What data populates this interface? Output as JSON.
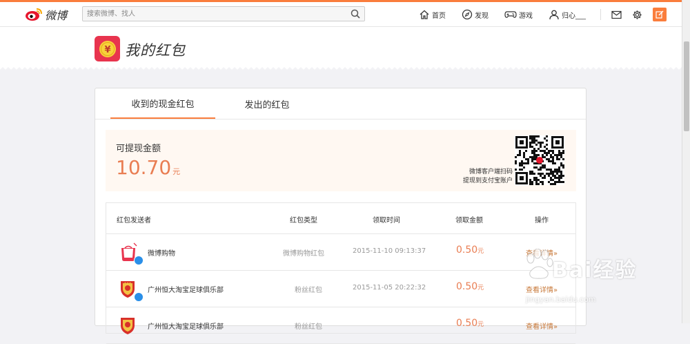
{
  "nav": {
    "logo_text": "微博",
    "search_placeholder": "搜索微博、找人",
    "items": [
      {
        "label": "首页",
        "icon": "home-icon"
      },
      {
        "label": "发现",
        "icon": "compass-icon"
      },
      {
        "label": "游戏",
        "icon": "gamepad-icon"
      },
      {
        "label": "归心___",
        "icon": "user-icon"
      }
    ],
    "right_icons": [
      "mail-icon",
      "gear-icon",
      "compose-icon"
    ]
  },
  "page": {
    "title": "我的红包",
    "hongbao_symbol": "¥"
  },
  "tabs": [
    {
      "label": "收到的现金红包",
      "active": true
    },
    {
      "label": "发出的红包",
      "active": false
    }
  ],
  "balance": {
    "label": "可提现金额",
    "amount": "10.70",
    "unit": "元",
    "qr_line1": "微博客户端扫码",
    "qr_line2": "提现到支付宝账户"
  },
  "table": {
    "headers": [
      "红包发送者",
      "红包类型",
      "领取时间",
      "领取金额",
      "操作"
    ],
    "rows": [
      {
        "sender": "微博购物",
        "type": "微博购物红包",
        "time": "2015-11-10 09:13:37",
        "amount": "0.50",
        "unit": "元",
        "action": "查看详情»"
      },
      {
        "sender": "广州恒大淘宝足球俱乐部",
        "type": "粉丝红包",
        "time": "2015-11-05 20:22:32",
        "amount": "0.50",
        "unit": "元",
        "action": "查看详情»"
      },
      {
        "sender": "广州恒大淘宝足球俱乐部",
        "type": "粉丝红包",
        "time": "",
        "amount": "0.50",
        "unit": "元",
        "action": "查看详情»"
      }
    ]
  },
  "watermark": {
    "text": "Bai经验",
    "url": "jingyan.baidu.com"
  },
  "colors": {
    "accent": "#fa7d3c",
    "amount": "#e97d52",
    "hongbao_red": "#e8344e",
    "verified_blue": "#2a8fe8"
  }
}
